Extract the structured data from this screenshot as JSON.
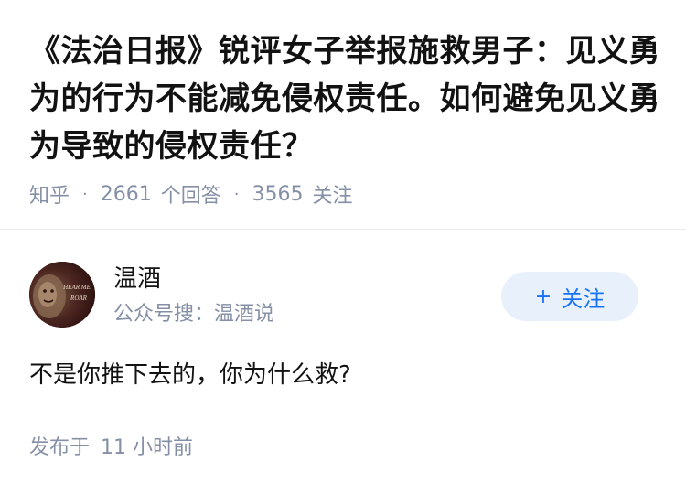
{
  "question": {
    "title": "《法治日报》锐评女子举报施救男子：见义勇为的行为不能减免侵权责任。如何避免见义勇为导致的侵权责任？"
  },
  "meta": {
    "source": "知乎",
    "separator": "·",
    "answer_count": "2661",
    "answer_label": "个回答",
    "follower_count": "3565",
    "follower_label": "关注"
  },
  "author": {
    "name": "温酒",
    "bio": "公众号搜：温酒说",
    "avatar_text_top": "HEAR ME",
    "avatar_text_bottom": "ROAR",
    "follow_plus": "+",
    "follow_label": "关注"
  },
  "answer": {
    "text": "不是你推下去的，你为什么救?"
  },
  "post": {
    "label": "发布于",
    "time": "11 小时前"
  },
  "colors": {
    "text": "#121212",
    "meta": "#8590a6",
    "accent": "#1772f6",
    "button_bg": "#e8f1fb"
  }
}
